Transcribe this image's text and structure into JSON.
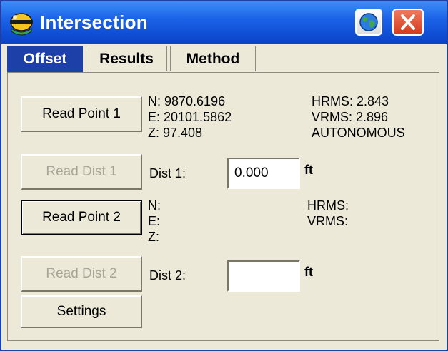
{
  "window": {
    "title": "Intersection"
  },
  "titlebar_icons": {
    "app": "surveyor-hardhat-icon",
    "globe": "globe-icon",
    "close": "close-icon"
  },
  "colors": {
    "title_blue": "#1c63e8",
    "active_tab": "#1c3fa8",
    "close_red": "#d6391a",
    "panel_bg": "#ece9d8"
  },
  "tabs": [
    {
      "label": "Offset",
      "active": true
    },
    {
      "label": "Results",
      "active": false
    },
    {
      "label": "Method",
      "active": false
    }
  ],
  "point1": {
    "button": "Read Point 1",
    "n": "N:  9870.6196",
    "e": "E:  20101.5862",
    "z": "Z:  97.408",
    "hrms": "HRMS:  2.843",
    "vrms": "VRMS:  2.896",
    "status": "AUTONOMOUS"
  },
  "dist1": {
    "button": "Read Dist 1",
    "label": "Dist 1:",
    "value": "0.000",
    "unit": "ft"
  },
  "point2": {
    "button": "Read Point 2",
    "n": "N:",
    "e": "E:",
    "z": "Z:",
    "hrms": "HRMS:",
    "vrms": "VRMS:"
  },
  "dist2": {
    "button": "Read Dist 2",
    "label": "Dist 2:",
    "value": "",
    "unit": "ft"
  },
  "settings": {
    "button": "Settings"
  }
}
